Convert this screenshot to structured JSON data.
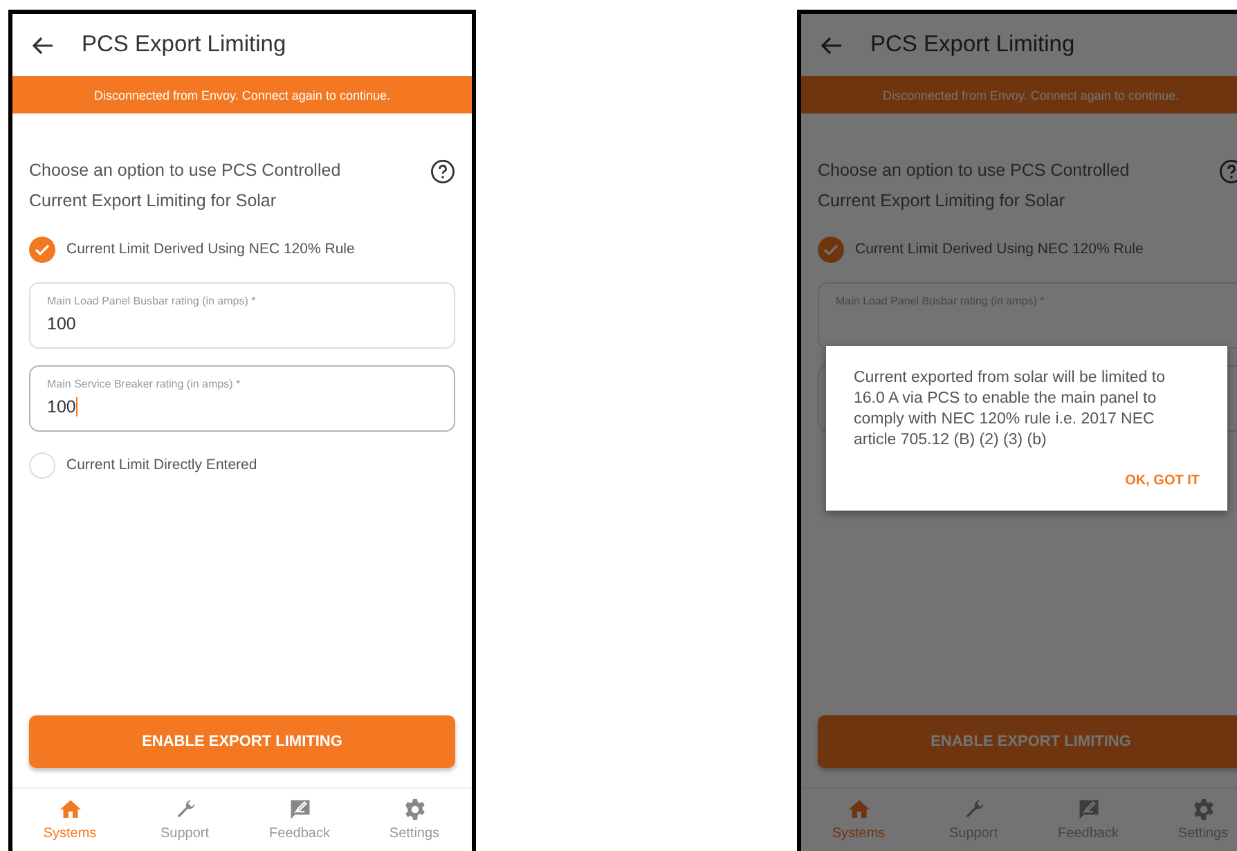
{
  "screens": [
    {
      "title": "PCS Export Limiting",
      "banner": "Disconnected from Envoy. Connect again to continue.",
      "question": "Choose an option to use PCS Controlled Current Export Limiting for Solar",
      "content": [
        {
          "kind": "option",
          "label": "Current Limit Derived Using NEC 120% Rule",
          "selected": true
        },
        {
          "kind": "field",
          "label": "Main Load Panel Busbar rating (in amps) *",
          "value": "100",
          "focused": false
        },
        {
          "kind": "field",
          "label": "Main Service Breaker rating (in amps) *",
          "value": "100",
          "focused": true
        },
        {
          "kind": "option",
          "label": "Current Limit Directly Entered",
          "selected": false
        }
      ],
      "action": "ENABLE EXPORT LIMITING",
      "nav": [
        {
          "kind": "home",
          "label": "Systems",
          "selected": true
        },
        {
          "kind": "wrench",
          "label": "Support",
          "selected": false
        },
        {
          "kind": "feedback",
          "label": "Feedback",
          "selected": false
        },
        {
          "kind": "gear",
          "label": "Settings",
          "selected": false
        }
      ]
    },
    {
      "title": "PCS Export Limiting",
      "banner": "Disconnected from Envoy. Connect again to continue.",
      "question": "Choose an option to use PCS Controlled Current Export Limiting for Solar",
      "content": [
        {
          "kind": "option",
          "label": "Current Limit Derived Using NEC 120% Rule",
          "selected": true
        },
        {
          "kind": "field",
          "label": "Main Load Panel Busbar rating (in amps) *"
        },
        {
          "kind": "field"
        }
      ],
      "action": "ENABLE EXPORT LIMITING",
      "nav": [
        {
          "kind": "home",
          "label": "Systems",
          "selected": true
        },
        {
          "kind": "wrench",
          "label": "Support",
          "selected": false
        },
        {
          "kind": "feedback",
          "label": "Feedback",
          "selected": false
        },
        {
          "kind": "gear",
          "label": "Settings",
          "selected": false
        }
      ],
      "dialog": {
        "message": "Current exported from solar will be limited to 16.0 A via PCS to enable the main panel to comply with NEC 120% rule i.e. 2017 NEC article 705.12 (B) (2) (3) (b)",
        "button": "OK, GOT IT"
      }
    }
  ]
}
